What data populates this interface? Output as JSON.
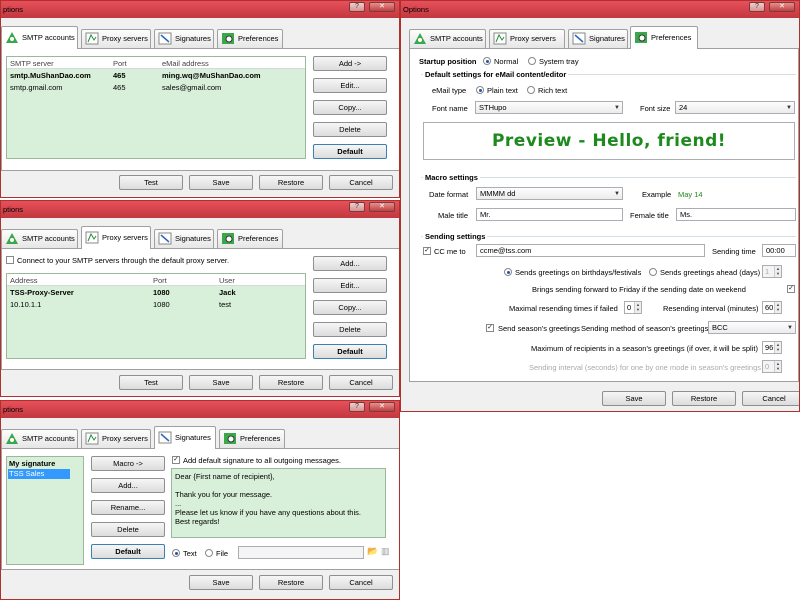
{
  "tabs": {
    "smtp": "SMTP accounts",
    "proxy": "Proxy servers",
    "sig": "Signatures",
    "prefs": "Preferences"
  },
  "w1": {
    "title": "ptions",
    "cols": [
      "SMTP server",
      "Port",
      "eMail address"
    ],
    "rows": [
      {
        "server": "smtp.MuShanDao.com",
        "port": "465",
        "email": "ming.wq@MuShanDao.com",
        "bold": true
      },
      {
        "server": "smtp.gmail.com",
        "port": "465",
        "email": "sales@gmail.com",
        "bold": false
      }
    ],
    "buttons": {
      "add": "Add ->",
      "edit": "Edit...",
      "copy": "Copy...",
      "delete": "Delete",
      "default": "Default"
    },
    "bottom": {
      "test": "Test",
      "save": "Save",
      "restore": "Restore",
      "cancel": "Cancel"
    }
  },
  "w2": {
    "title": "ptions",
    "checkbox": "Connect to your SMTP servers through the default proxy server.",
    "cols": [
      "Address",
      "Port",
      "User"
    ],
    "rows": [
      {
        "address": "TSS-Proxy-Server",
        "port": "1080",
        "user": "Jack",
        "bold": true
      },
      {
        "address": "10.10.1.1",
        "port": "1080",
        "user": "test",
        "bold": false
      }
    ],
    "buttons": {
      "add": "Add...",
      "edit": "Edit...",
      "copy": "Copy...",
      "delete": "Delete",
      "default": "Default"
    },
    "bottom": {
      "test": "Test",
      "save": "Save",
      "restore": "Restore",
      "cancel": "Cancel"
    }
  },
  "w3": {
    "title": "ptions",
    "list": [
      "My signature",
      "TSS Sales"
    ],
    "buttons": {
      "macro": "Macro ->",
      "add": "Add...",
      "rename": "Rename...",
      "delete": "Delete",
      "default": "Default"
    },
    "checkbox": "Add default signature to all outgoing messages.",
    "body": [
      "Dear {First name of recipient},",
      "",
      "Thank you for your message.",
      "...",
      "Please let us know if you have any questions about this.",
      "Best regards!"
    ],
    "text_radio": "Text",
    "file_radio": "File",
    "bottom": {
      "save": "Save",
      "restore": "Restore",
      "cancel": "Cancel"
    }
  },
  "w4": {
    "title": "Options",
    "startup_label": "Startup position",
    "startup_normal": "Normal",
    "startup_tray": "System tray",
    "editor_group": "Default settings for eMail content/editor",
    "email_type_label": "eMail type",
    "plain_text": "Plain text",
    "rich_text": "Rich text",
    "font_name_label": "Font name",
    "font_name": "STHupo",
    "font_size_label": "Font size",
    "font_size": "24",
    "preview": "Preview - Hello, friend!",
    "macro_group": "Macro settings",
    "date_format_label": "Date format",
    "date_format": "MMMM dd",
    "example_label": "Example",
    "example_value": "May 14",
    "male_title_label": "Male title",
    "male_title": "Mr.",
    "female_title_label": "Female title",
    "female_title": "Ms.",
    "sending_group": "Sending settings",
    "cc_me_label": "CC me to",
    "cc_me": "ccme@tss.com",
    "sending_time_label": "Sending time",
    "sending_time": "00:00",
    "greet_birthdays": "Sends greetings on birthdays/festivals",
    "greet_ahead": "Sends greetings ahead (days)",
    "greet_ahead_value": "1",
    "bring_forward": "Brings sending forward to Friday if the sending date on weekend",
    "max_resend_label": "Maximal resending times if failed",
    "max_resend": "0",
    "resend_interval_label": "Resending interval (minutes)",
    "resend_interval": "60",
    "season_send": "Send season's greetings",
    "season_method_label": "Sending method of season's greetings",
    "season_method": "BCC",
    "max_recipients_label": "Maximum of recipients in a season's greetings (if over, it will be split)",
    "max_recipients": "96",
    "interval_one_label": "Sending interval (seconds) for one by one mode in season's greetings",
    "interval_one": "0",
    "bottom": {
      "save": "Save",
      "restore": "Restore",
      "cancel": "Cancel"
    }
  },
  "colors": {
    "title_bar": "#c8404a",
    "grid_bg": "#d8efd9",
    "preview_text": "#1e8a1e",
    "example_text": "#1e8a1e"
  }
}
